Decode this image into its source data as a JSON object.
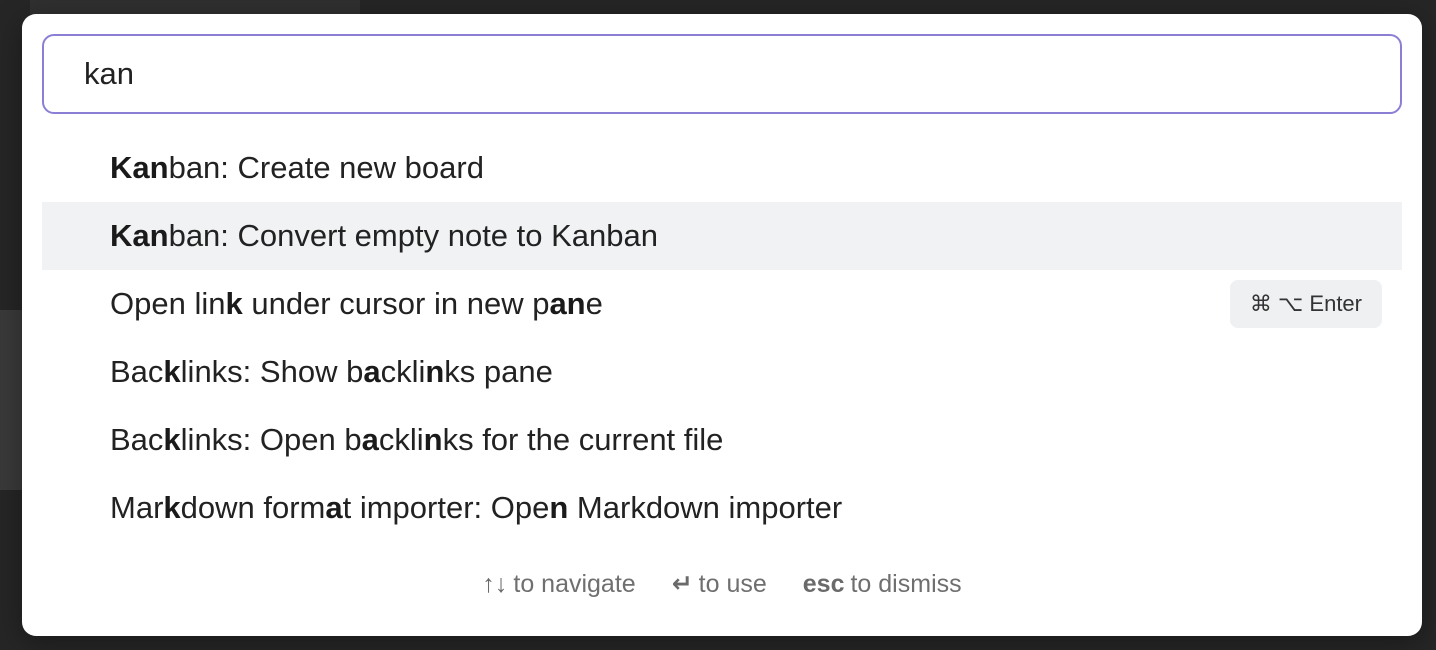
{
  "palette": {
    "query": "kan",
    "suggestions": [
      {
        "parts": [
          {
            "text": "Kan",
            "bold": true
          },
          {
            "text": "ban: Create new board",
            "bold": false
          }
        ],
        "selected": false,
        "hotkey": null
      },
      {
        "parts": [
          {
            "text": "Kan",
            "bold": true
          },
          {
            "text": "ban: Convert empty note to Kanban",
            "bold": false
          }
        ],
        "selected": true,
        "hotkey": null
      },
      {
        "parts": [
          {
            "text": "Open lin",
            "bold": false
          },
          {
            "text": "k",
            "bold": true
          },
          {
            "text": " under cursor in new p",
            "bold": false
          },
          {
            "text": "an",
            "bold": true
          },
          {
            "text": "e",
            "bold": false
          }
        ],
        "selected": false,
        "hotkey": "⌘ ⌥ Enter"
      },
      {
        "parts": [
          {
            "text": "Bac",
            "bold": false
          },
          {
            "text": "k",
            "bold": true
          },
          {
            "text": "links: Show b",
            "bold": false
          },
          {
            "text": "a",
            "bold": true
          },
          {
            "text": "ckli",
            "bold": false
          },
          {
            "text": "n",
            "bold": true
          },
          {
            "text": "ks pane",
            "bold": false
          }
        ],
        "selected": false,
        "hotkey": null
      },
      {
        "parts": [
          {
            "text": "Bac",
            "bold": false
          },
          {
            "text": "k",
            "bold": true
          },
          {
            "text": "links: Open b",
            "bold": false
          },
          {
            "text": "a",
            "bold": true
          },
          {
            "text": "ckli",
            "bold": false
          },
          {
            "text": "n",
            "bold": true
          },
          {
            "text": "ks for the current file",
            "bold": false
          }
        ],
        "selected": false,
        "hotkey": null
      },
      {
        "parts": [
          {
            "text": "Mar",
            "bold": false
          },
          {
            "text": "k",
            "bold": true
          },
          {
            "text": "down form",
            "bold": false
          },
          {
            "text": "a",
            "bold": true
          },
          {
            "text": "t importer: Ope",
            "bold": false
          },
          {
            "text": "n",
            "bold": true
          },
          {
            "text": " Markdown importer",
            "bold": false
          }
        ],
        "selected": false,
        "hotkey": null
      }
    ],
    "instructions": [
      {
        "command": "↑↓",
        "purpose": "to navigate"
      },
      {
        "command": "↵",
        "purpose": "to use"
      },
      {
        "command": "esc",
        "purpose": "to dismiss"
      }
    ]
  },
  "colors": {
    "accent_border": "#8a7fd4",
    "selected_row": "#f1f2f4",
    "backdrop": "#2a2a2a"
  }
}
